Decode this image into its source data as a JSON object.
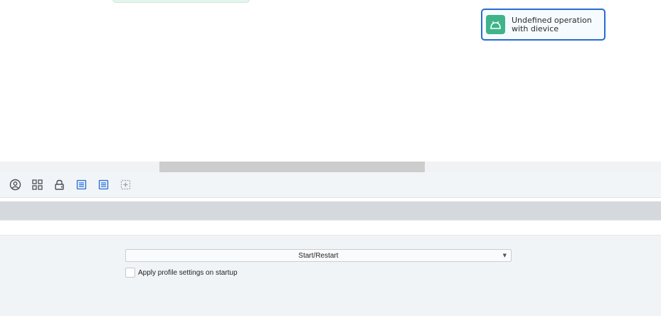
{
  "canvas": {
    "node": {
      "label": "Undefined operation\nwith dievice",
      "icon": "android-icon",
      "icon_bg": "#3fb38a",
      "border_color": "#2a6bd1"
    }
  },
  "toolbar": {
    "tools": [
      {
        "icon": "user-circle-icon"
      },
      {
        "icon": "grid-icon"
      },
      {
        "icon": "lock-icon"
      },
      {
        "icon": "list-icon"
      },
      {
        "icon": "list-icon"
      },
      {
        "icon": "add-node-icon"
      }
    ]
  },
  "settings": {
    "action_select": {
      "value": "Start/Restart"
    },
    "apply_profile": {
      "label": "Apply profile settings on startup",
      "checked": false
    }
  }
}
